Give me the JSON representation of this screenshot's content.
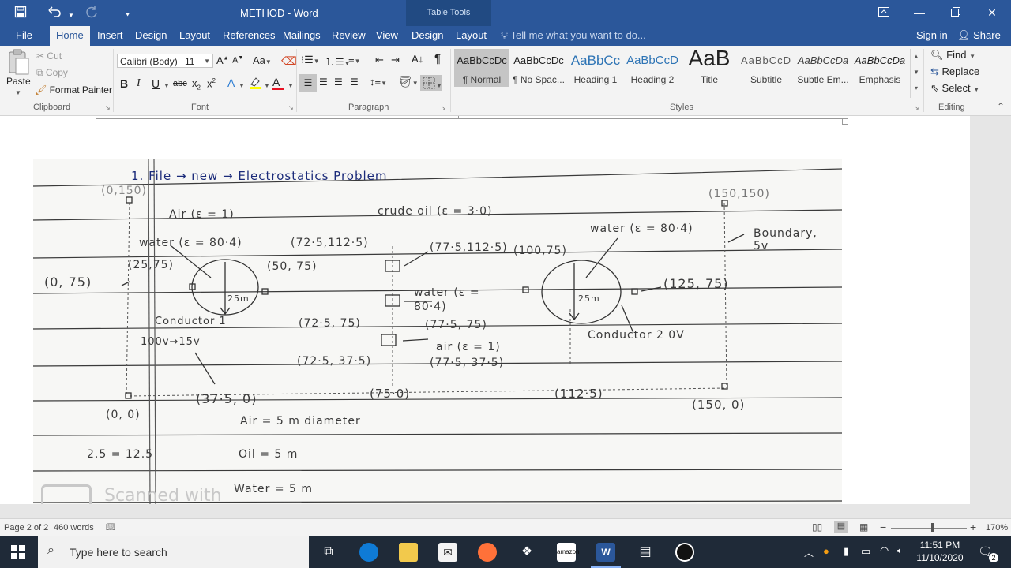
{
  "window": {
    "title": "METHOD  -  Word",
    "context_tab": "Table Tools"
  },
  "tabs": [
    {
      "label": "File"
    },
    {
      "label": "Home"
    },
    {
      "label": "Insert"
    },
    {
      "label": "Design"
    },
    {
      "label": "Layout"
    },
    {
      "label": "References"
    },
    {
      "label": "Mailings"
    },
    {
      "label": "Review"
    },
    {
      "label": "View"
    },
    {
      "label": "Design"
    },
    {
      "label": "Layout"
    }
  ],
  "tell_me": "Tell me what you want to do...",
  "account": {
    "sign_in": "Sign in",
    "share": "Share"
  },
  "ribbon": {
    "clipboard": {
      "paste": "Paste",
      "cut": "Cut",
      "copy": "Copy",
      "format_painter": "Format Painter",
      "label": "Clipboard"
    },
    "font": {
      "name": "Calibri (Body)",
      "size": "11",
      "label": "Font"
    },
    "paragraph": {
      "label": "Paragraph"
    },
    "styles": {
      "label": "Styles",
      "items": [
        {
          "sample": "AaBbCcDc",
          "name": "¶ Normal"
        },
        {
          "sample": "AaBbCcDc",
          "name": "¶ No Spac..."
        },
        {
          "sample": "AaBbCc",
          "name": "Heading 1"
        },
        {
          "sample": "AaBbCcD",
          "name": "Heading 2"
        },
        {
          "sample": "AaB",
          "name": "Title"
        },
        {
          "sample": "AaBbCcD",
          "name": "Subtitle"
        },
        {
          "sample": "AaBbCcDa",
          "name": "Subtle Em..."
        },
        {
          "sample": "AaBbCcDa",
          "name": "Emphasis"
        }
      ]
    },
    "editing": {
      "find": "Find",
      "replace": "Replace",
      "select": "Select",
      "label": "Editing"
    }
  },
  "scan_text": {
    "heading": "1. File → new → Electrostatics  Problem",
    "l1": "(0,150)",
    "l2": "(150,150)",
    "l3": "Air (ε = 1)",
    "l4": "crude oil (ε = 3·0)",
    "l5": "water (ε = 80·4)",
    "l6": "water (ε = 80·4)",
    "l7": "Boundary, 5v",
    "l8": "(72·5,112·5)",
    "l9": "(77·5,112·5)",
    "l10": "(100,75)",
    "l11": "(25,75)",
    "l12": "(50, 75)",
    "l13": "(0, 75)",
    "l14": "(125, 75)",
    "l15": "25m",
    "l16": "25m",
    "l17": "water (ε = 80·4)",
    "l18": "Conductor 1",
    "l19": "100v→15v",
    "l20": "(72·5, 75)",
    "l21": "(77·5, 75)",
    "l22": "Conductor 2   0V",
    "l23": "air (ε = 1)",
    "l24": "(72·5, 37·5)",
    "l25": "(77·5, 37·5)",
    "l26": "(37·5, 0)",
    "l27": "(75·0)",
    "l28": "(112·5)",
    "l29": "(150, 0)",
    "l30": "(0, 0)",
    "l31": "Air  =  5 m  diameter",
    "l32": "2.5 = 12.5",
    "l33": "Oil  =  5 m",
    "l34": "Water = 5 m",
    "l35": "Scanned with"
  },
  "status": {
    "page": "Page 2 of 2",
    "words": "460 words",
    "zoom": "170%"
  },
  "taskbar": {
    "search_placeholder": "Type here to search",
    "time": "11:51 PM",
    "date": "11/10/2020",
    "notifications": "2"
  }
}
